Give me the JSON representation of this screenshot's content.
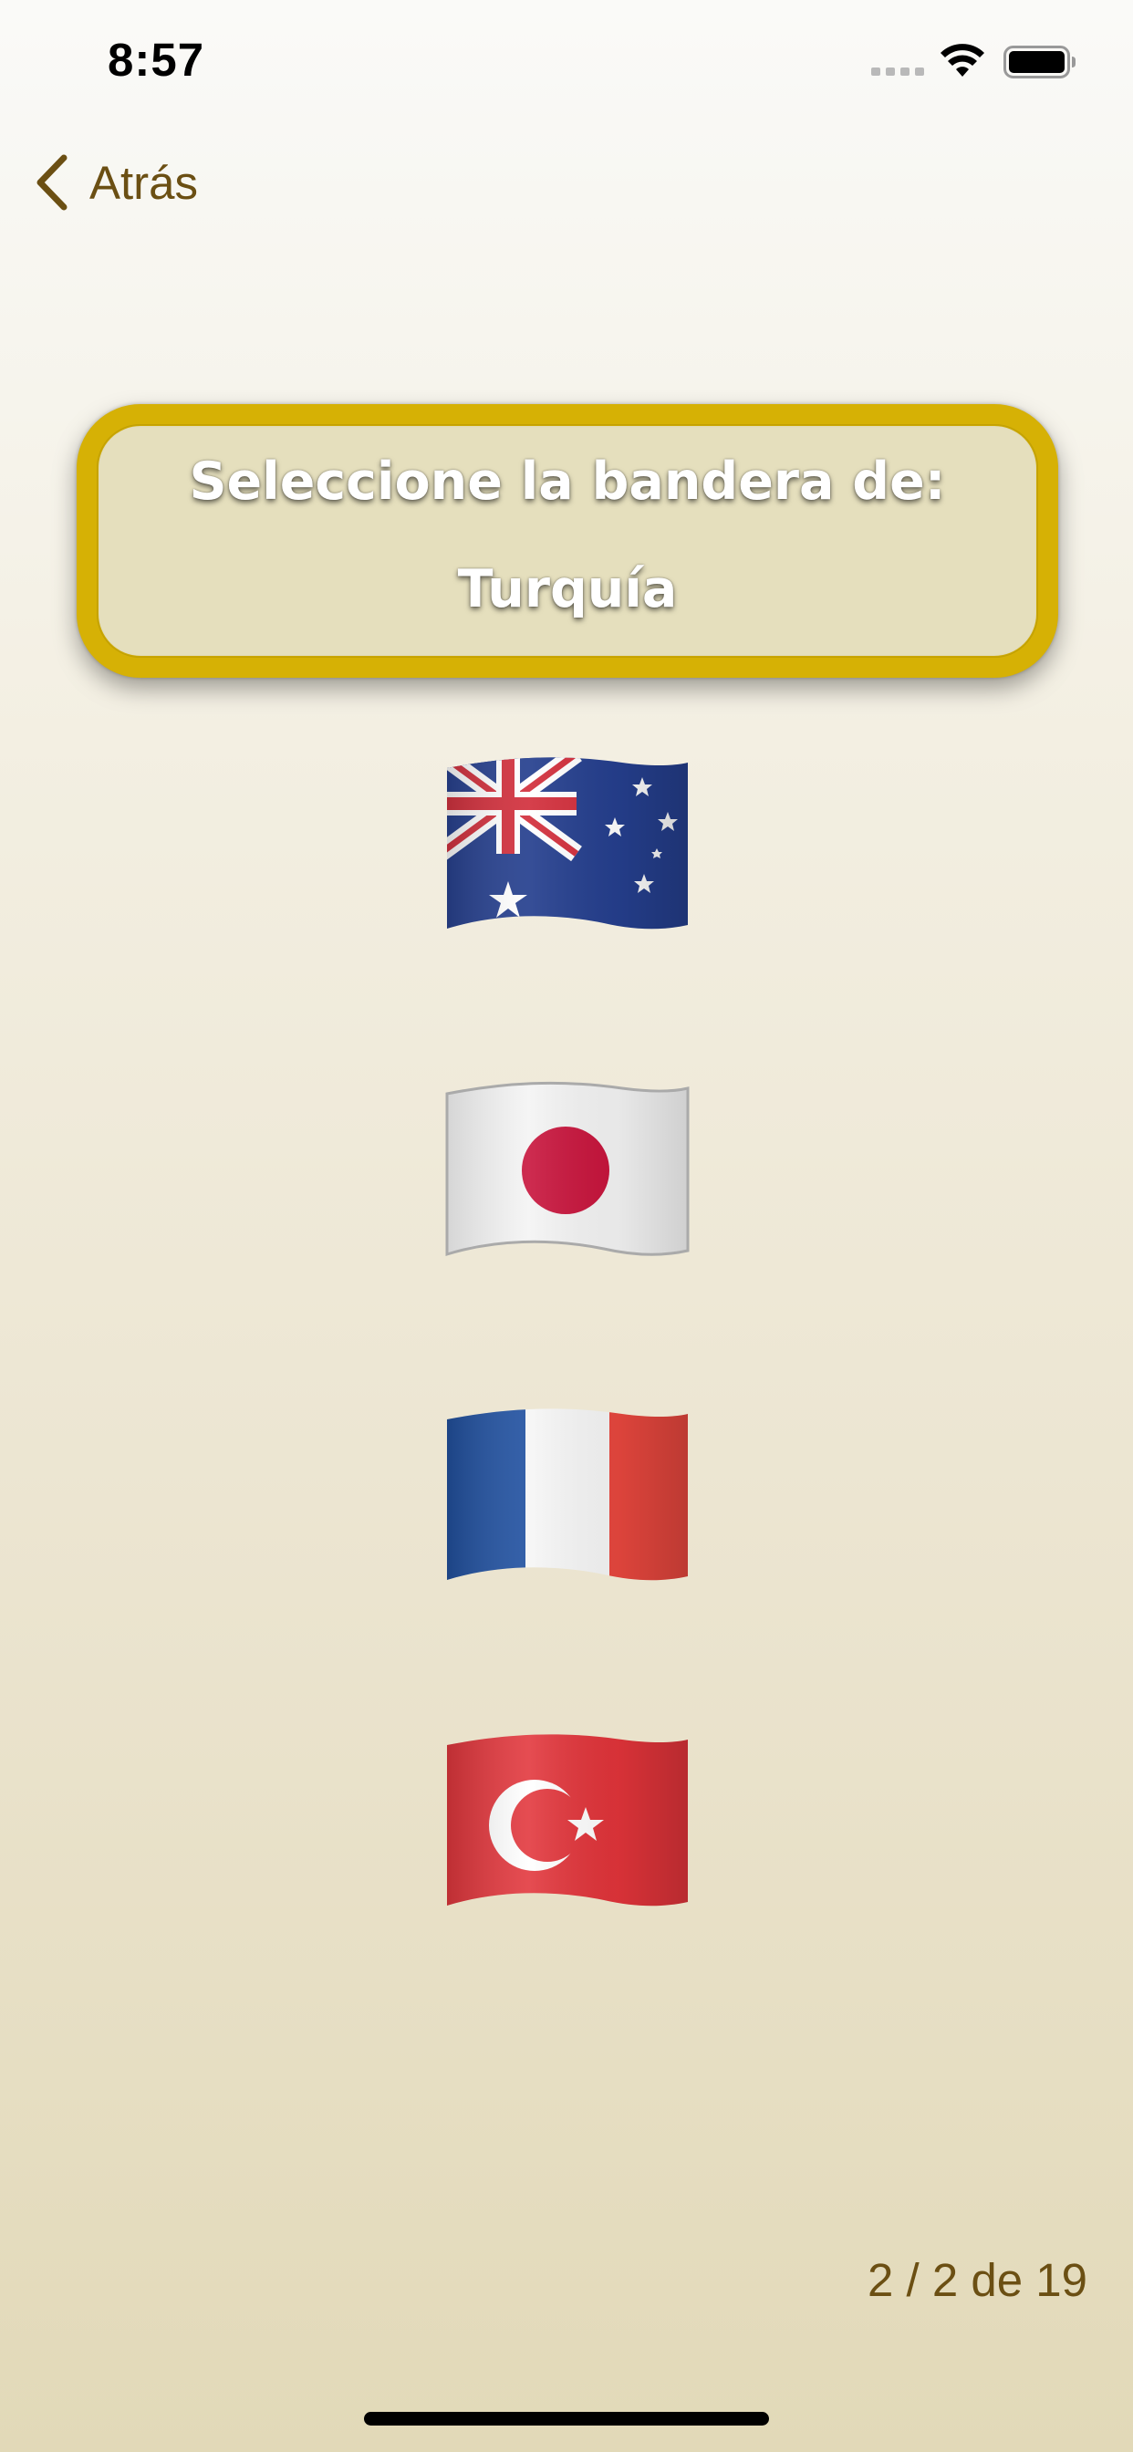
{
  "status_bar": {
    "time": "8:57",
    "icons": [
      "signal-icon",
      "wifi-icon",
      "battery-icon"
    ]
  },
  "navigation": {
    "back_label": "Atrás",
    "back_icon": "chevron-left-icon",
    "accent_color": "#6b4f13"
  },
  "prompt": {
    "line1": "Seleccione la bandera de:",
    "country": "Turquía",
    "border_color": "#d6b105",
    "fill_color": "#e5dfbd"
  },
  "options": [
    {
      "flag": "Australia",
      "icon": "australia-flag-icon"
    },
    {
      "flag": "Japan",
      "icon": "japan-flag-icon"
    },
    {
      "flag": "France",
      "icon": "france-flag-icon"
    },
    {
      "flag": "Turkey",
      "icon": "turkey-flag-icon"
    }
  ],
  "progress": {
    "text": "2 / 2 de 19"
  }
}
